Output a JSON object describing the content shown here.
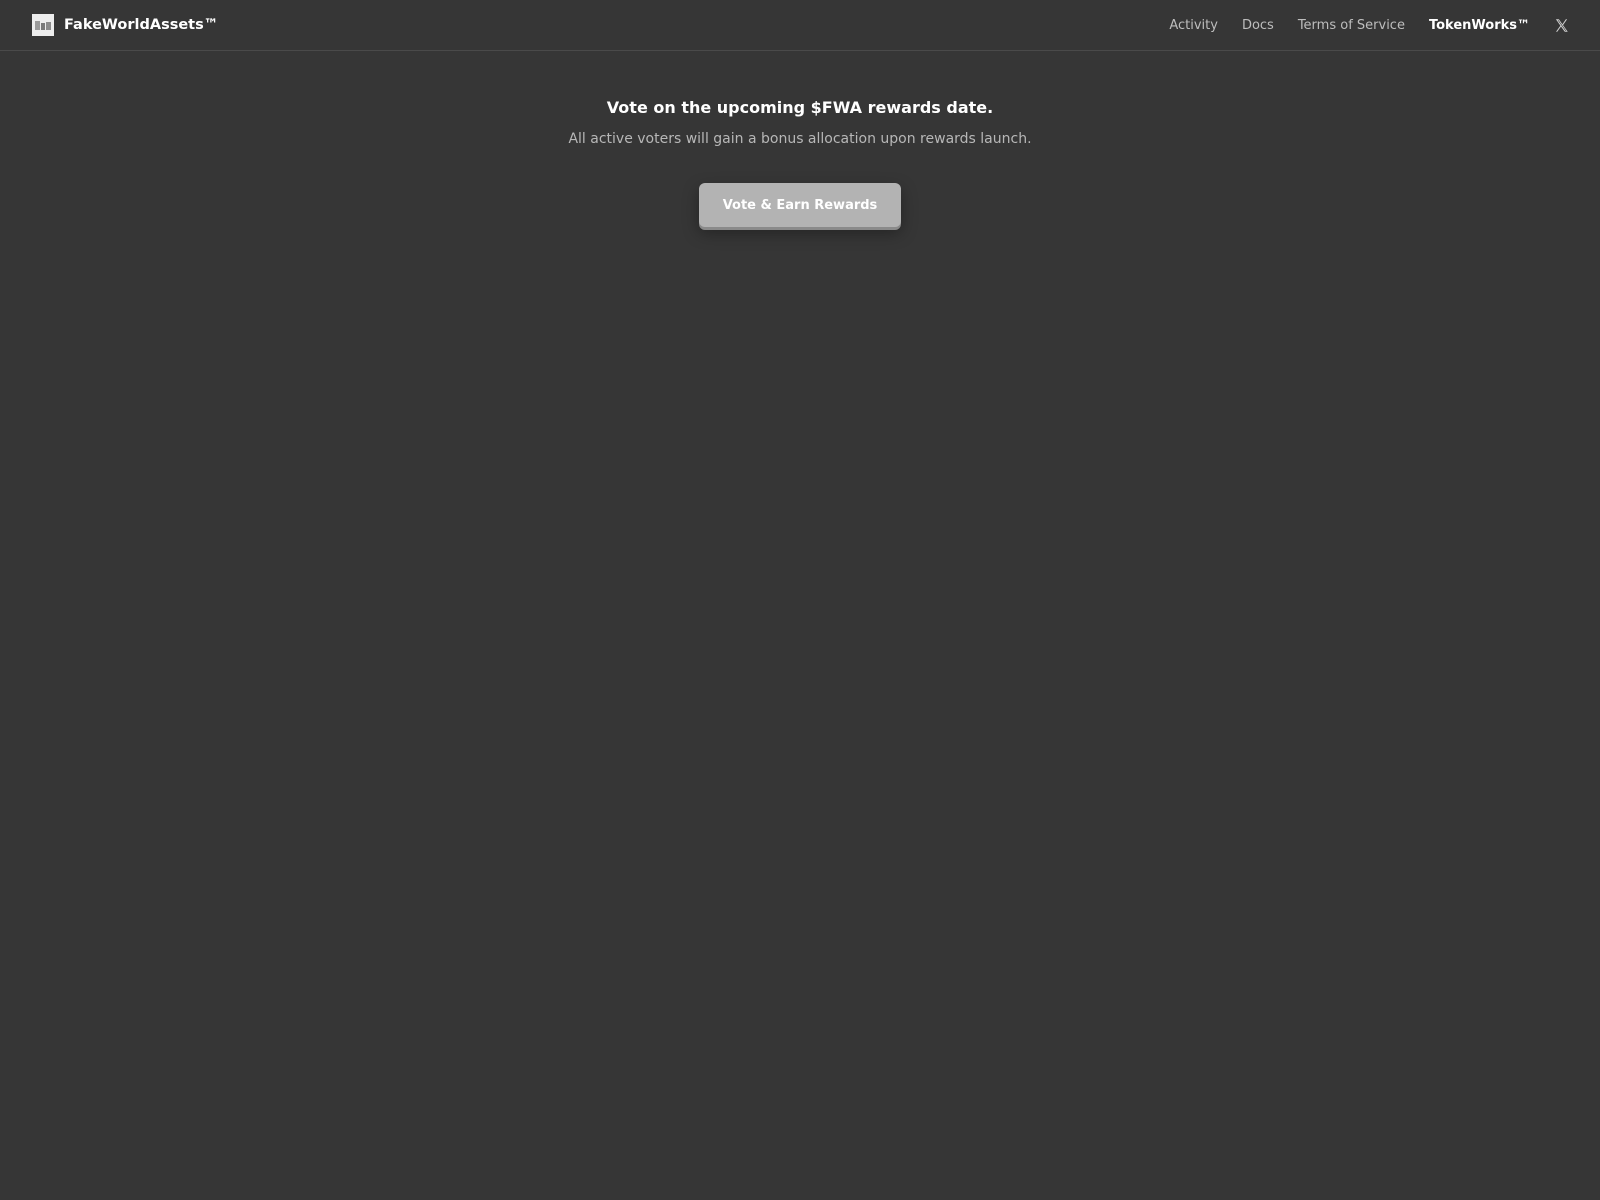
{
  "header": {
    "brand_name": "FakeWorldAssets™",
    "logo_icon": "brand-logo-icon",
    "nav": [
      {
        "label": "Activity"
      },
      {
        "label": "Docs"
      },
      {
        "label": "Terms of Service"
      },
      {
        "label": "TokenWorks™"
      }
    ],
    "social_icon": "x-twitter-icon"
  },
  "hero": {
    "title": "Vote on the upcoming $FWA rewards date.",
    "subtitle": "All active voters will gain a bonus allocation upon rewards launch.",
    "cta_label": "Vote & Earn Rewards"
  },
  "colors": {
    "background": "#363636",
    "button": "#b3b3b3",
    "text_primary": "#ffffff",
    "text_secondary": "#b7b7b7"
  }
}
